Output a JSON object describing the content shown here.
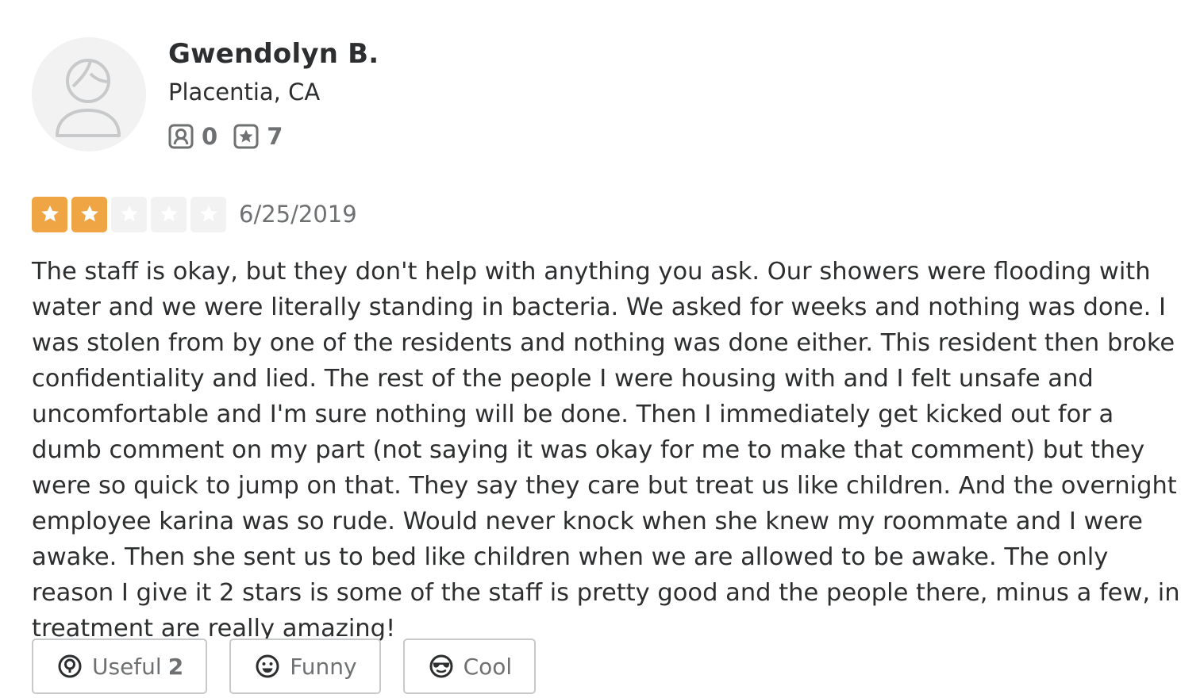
{
  "user": {
    "name": "Gwendolyn B.",
    "location": "Placentia, CA",
    "friends_count": "0",
    "reviews_count": "7",
    "avatar_icon": "default-user-avatar-icon",
    "friends_icon": "friends-icon",
    "reviews_icon": "review-star-icon"
  },
  "review": {
    "rating": 2,
    "rating_max": 5,
    "date": "6/25/2019",
    "text": "The staff is okay, but they don't help with anything you ask. Our showers were flooding with water and we were literally standing in bacteria. We asked for weeks and nothing was done. I was stolen from by one of the residents and nothing was done either. This resident then broke confidentiality and lied. The rest of the people I were housing with and I felt unsafe and uncomfortable and I'm sure nothing will be done. Then I immediately get kicked out for a dumb comment on my part (not saying it was okay for me to make that comment) but they were so quick to jump on that. They say they care but treat us like children. And the overnight employee karina was so rude. Would never knock when she knew my roommate and I were awake. Then she sent us to bed like children when we are allowed to be awake. The only reason I give it 2 stars is some of the staff is pretty good and the people there, minus a few, in treatment are really amazing!"
  },
  "reactions": {
    "useful_label": "Useful",
    "useful_count": "2",
    "funny_label": "Funny",
    "cool_label": "Cool"
  },
  "colors": {
    "star_filled": "#f0a545",
    "star_empty": "#f2f2f2",
    "text_primary": "#2d2e2f",
    "text_secondary": "#6e7072",
    "button_border": "#c8c9ca"
  }
}
